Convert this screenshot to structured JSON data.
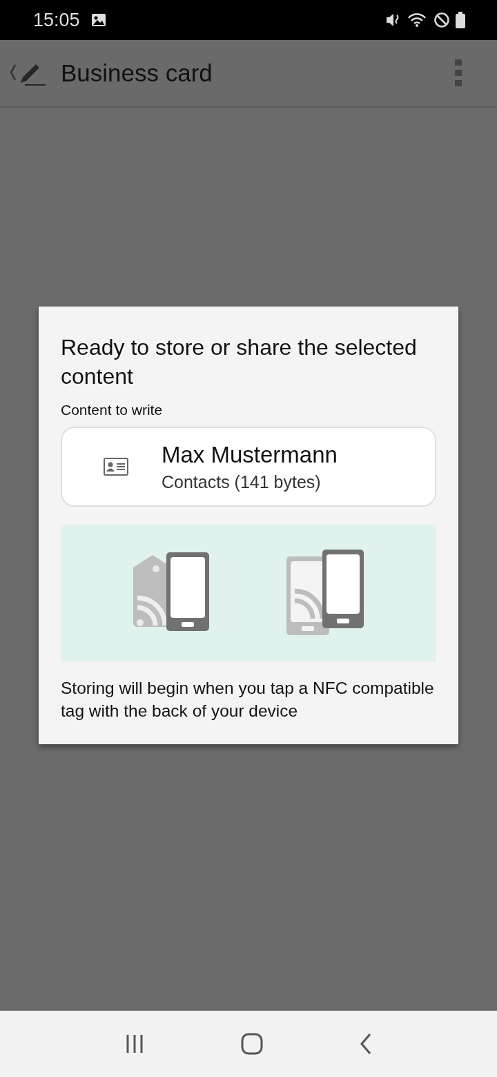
{
  "status_bar": {
    "time": "15:05"
  },
  "app_bar": {
    "title": "Business card"
  },
  "dialog": {
    "title": "Ready to store or share the selected content",
    "label": "Content to write",
    "item": {
      "name": "Max Mustermann",
      "detail": "Contacts (141 bytes)"
    },
    "message": "Storing will begin when you tap a NFC compatible tag with the back of your device"
  }
}
